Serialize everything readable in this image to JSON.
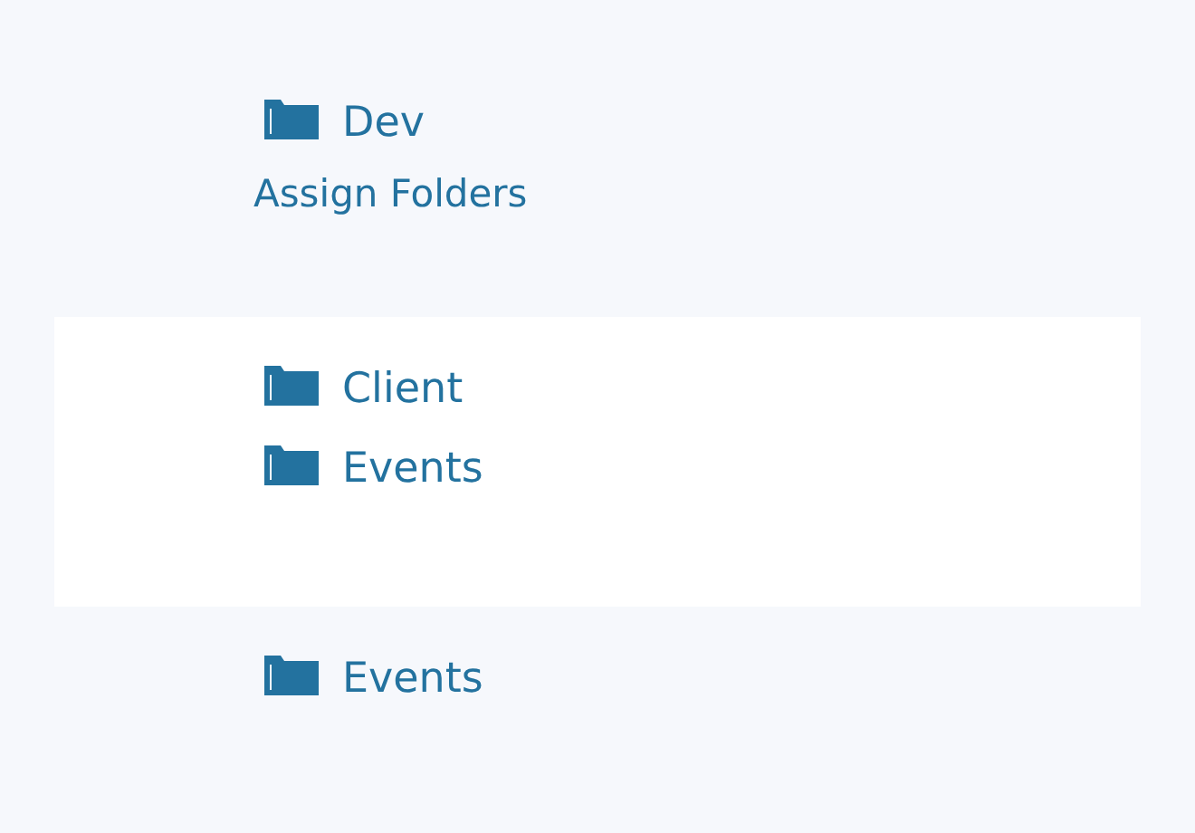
{
  "top_folders": [
    {
      "name": "Dev"
    }
  ],
  "section_title": "Assign Folders",
  "assigned_panel": {
    "folders": [
      {
        "name": "Client"
      },
      {
        "name": "Events"
      }
    ]
  },
  "bottom_folders": [
    {
      "name": "Events"
    }
  ]
}
